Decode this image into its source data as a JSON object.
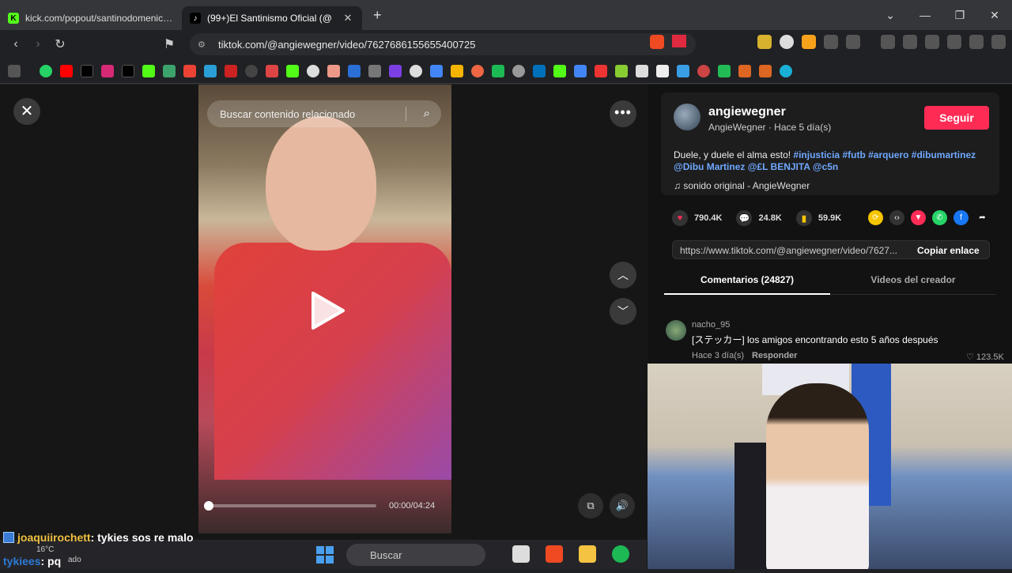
{
  "browser": {
    "tabs": [
      {
        "title": "kick.com/popout/santinodomenichin",
        "icon": "kick-icon",
        "active": false
      },
      {
        "title": "(99+)El Santinismo Oficial (@",
        "icon": "tiktok-icon",
        "active": true
      }
    ],
    "url": "tiktok.com/@angiewegner/video/7627686155655400725"
  },
  "video": {
    "search_placeholder": "Buscar contenido relacionado",
    "timecode": "00:00/04:24",
    "progress_fraction": 0.0
  },
  "chat": [
    {
      "user": "joaquiirochett",
      "message": " : tykies sos re malo"
    },
    {
      "user": "tykiees",
      "message": " : pq"
    }
  ],
  "taskbar": {
    "weather_temp": "16°C",
    "weather_desc": "ado",
    "search": "Buscar"
  },
  "post": {
    "author": "angiewegner",
    "subline": "AngieWegner · Hace 5 día(s)",
    "follow": "Seguir",
    "caption_text": "Duele, y duele el alma esto! ",
    "caption_tags_1": "#injusticia #futb #arquero #dibumartinez",
    "caption_tags_2": "@Dibu Martinez @£L BENJITA @c5n",
    "sound": "sonido original - AngieWegner",
    "likes": "790.4K",
    "comments": "24.8K",
    "saves": "59.9K",
    "link": "https://www.tiktok.com/@angiewegner/video/7627...",
    "copy_link": "Copiar enlace",
    "tab_comments": "Comentarios (24827)",
    "tab_creator": "Videos del creador"
  },
  "comment": {
    "user": "nacho_95",
    "text": "[ステッカー] los amigos encontrando esto 5 años después",
    "time": "Hace 3 día(s)",
    "reply": "Responder",
    "likes": "♡ 123.5K"
  },
  "colors": {
    "follow": "#fe2c55",
    "tags": "#6fa8ff",
    "chat_user": "#f0c040"
  }
}
